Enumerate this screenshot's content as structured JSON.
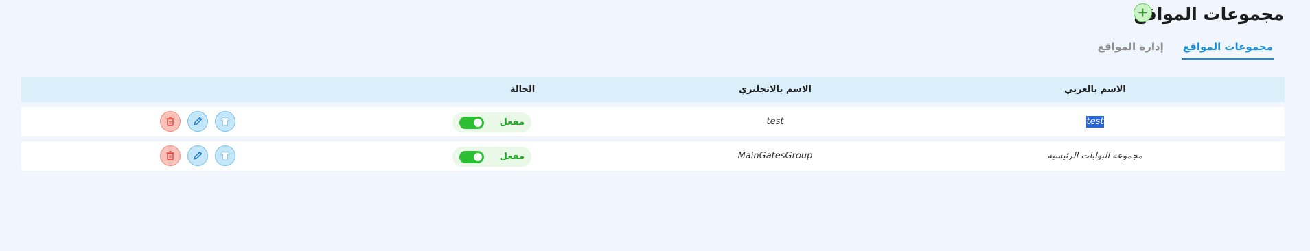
{
  "header": {
    "title": "مجموعات المواقع",
    "add_icon": "plus-icon"
  },
  "tabs": [
    {
      "label": "إدارة المواقع",
      "active": false
    },
    {
      "label": "مجموعات المواقع",
      "active": true
    }
  ],
  "table": {
    "columns": {
      "arabic_name": "الاسم بالعربي",
      "english_name": "الاسم بالانجليزي",
      "status": "الحالة"
    },
    "rows": [
      {
        "arabic_name": "test",
        "english_name": "test",
        "status": "مفعل",
        "enabled": true
      },
      {
        "arabic_name": "مجموعة البوابات الرئيسية",
        "english_name": "MainGatesGroup",
        "status": "مفعل",
        "enabled": true
      }
    ],
    "actions": [
      "view-icon",
      "edit-icon",
      "delete-icon"
    ]
  },
  "colors": {
    "accent": "#1a8fd6",
    "enabled_green": "#2cbf33",
    "delete_red": "#ee8d80",
    "header_bg": "#dbeffb",
    "page_bg": "#f1f5fd"
  }
}
